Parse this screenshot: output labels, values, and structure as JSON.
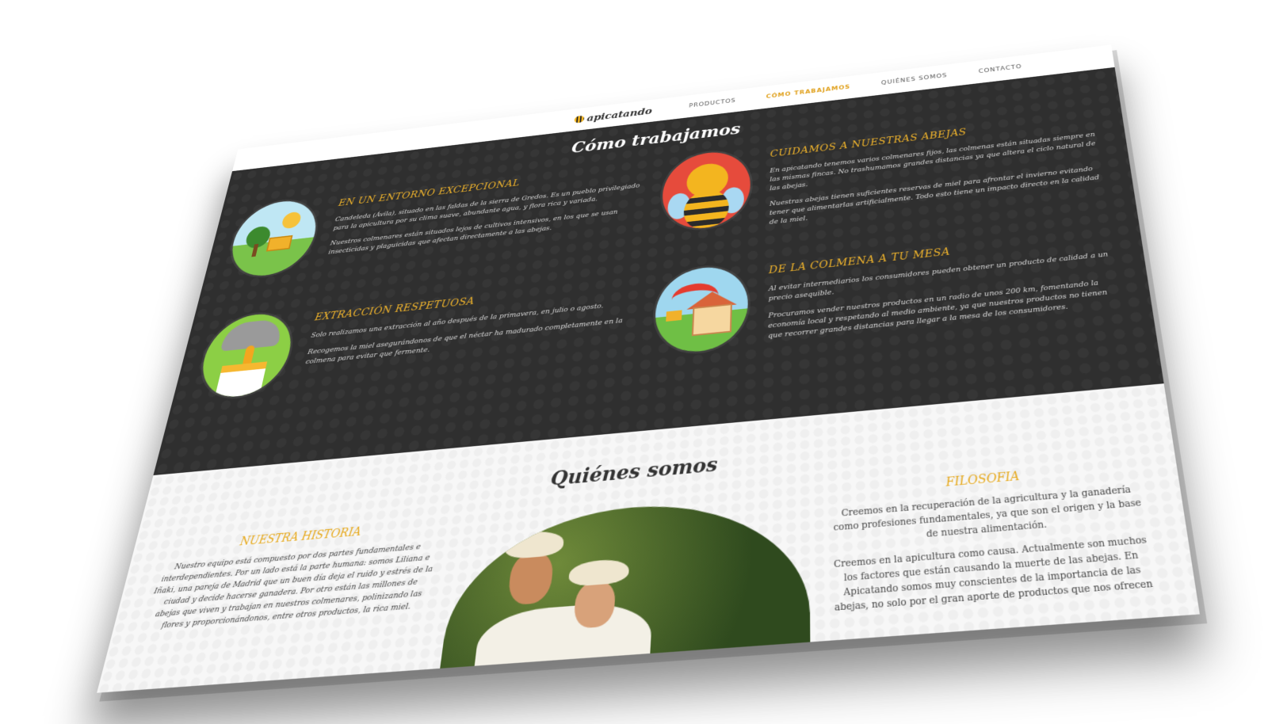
{
  "nav": {
    "logo": "apicatando",
    "items": [
      "PRODUCTOS",
      "CÓMO TRABAJAMOS",
      "QUIÉNES SOMOS",
      "CONTACTO"
    ],
    "active_index": 1,
    "active_color": "#e0a01b"
  },
  "como": {
    "title": "Cómo trabajamos",
    "cards": [
      {
        "title": "EN UN ENTORNO EXCEPCIONAL",
        "p1": "Candeleda (Ávila), situado en las faldas de la sierra de Gredos. Es un pueblo privilegiado para la apicultura por su clima suave, abundante agua, y flora rica y variada.",
        "p2": "Nuestros colmenares están situados lejos de cultivos intensivos, en los que se usan insecticidas y plaguicidas que afectan directamente a las abejas.",
        "icon": "landscape-icon"
      },
      {
        "title": "CUIDAMOS A NUESTRAS ABEJAS",
        "p1": "En apicatando tenemos varios colmenares fijos, las colmenas están situadas siempre en las mismas fincas. No trashumamos grandes distancias ya que altera el ciclo natural de las abejas.",
        "p2": "Nuestras abejas tienen suficientes reservas de miel para afrontar el invierno evitando tener que alimentarlas artificialmente. Todo esto tiene un impacto directo en la calidad de la miel.",
        "icon": "bee-icon"
      },
      {
        "title": "EXTRACCIÓN RESPETUOSA",
        "p1": "Solo realizamos una extracción al año después de la primavera, en julio o agosto.",
        "p2": "Recogemos la miel asegurándonos de que el néctar ha madurado completamente en la colmena para evitar que fermente.",
        "icon": "honey-extractor-icon"
      },
      {
        "title": "DE LA COLMENA A TU MESA",
        "p1": "Al evitar intermediarios los consumidores pueden obtener un producto de calidad a un precio asequible.",
        "p2": "Procuramos vender nuestros productos en un radio de unos 200 km, fomentando la economía local y respetando al medio ambiente, ya que nuestros productos no tienen que recorrer grandes distancias para llegar a la mesa de los consumidores.",
        "icon": "hive-to-home-icon"
      }
    ]
  },
  "quienes": {
    "title": "Quiénes somos",
    "historia_title": "NUESTRA HISTORIA",
    "historia_text": "Nuestro equipo está compuesto por dos partes fundamentales e interdependientes. Por un lado está la parte humana: somos Liliana e Iñaki, una pareja de Madrid que un buen día deja el ruido y estrés de la ciudad y decide hacerse ganadera. Por otro están las millones de abejas que viven y trabajan en nuestros colmenares, polinizando las flores y proporcionándonos, entre otros productos, la rica miel.",
    "filosofia_title": "FILOSOFIA",
    "filosofia_p1": "Creemos en la recuperación de la agricultura y la ganadería como profesiones fundamentales, ya que son el origen y la base de nuestra alimentación.",
    "filosofia_p2": "Creemos en la apicultura como causa. Actualmente son muchos los factores que están causando la muerte de las abejas. En Apicatando somos muy conscientes de la importancia de las abejas, no solo por el gran aporte de productos que nos ofrecen"
  }
}
